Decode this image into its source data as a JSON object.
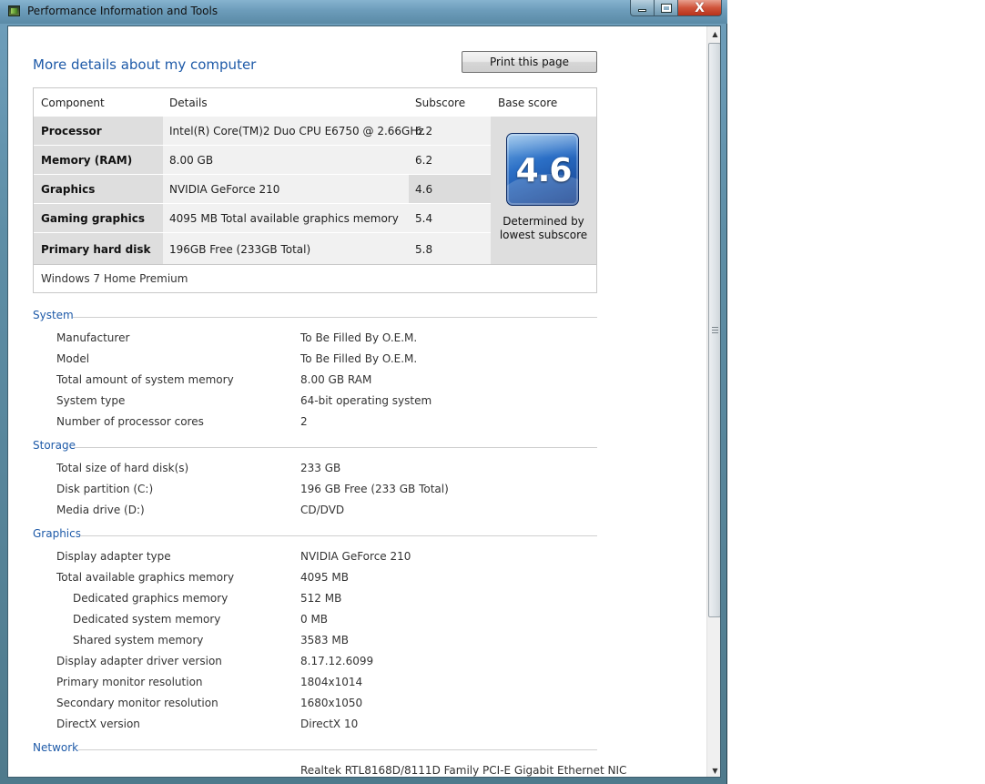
{
  "window": {
    "title": "Performance Information and Tools",
    "minimize_label": "",
    "maximize_label": "",
    "close_label": "X"
  },
  "page": {
    "heading": "More details about my computer",
    "print_label": "Print this page"
  },
  "score_table": {
    "headers": {
      "component": "Component",
      "details": "Details",
      "subscore": "Subscore",
      "base_score": "Base score"
    },
    "rows": [
      {
        "component": "Processor",
        "details": "Intel(R) Core(TM)2 Duo CPU E6750 @ 2.66GHz",
        "subscore": "6.2"
      },
      {
        "component": "Memory (RAM)",
        "details": "8.00 GB",
        "subscore": "6.2"
      },
      {
        "component": "Graphics",
        "details": "NVIDIA GeForce 210",
        "subscore": "4.6"
      },
      {
        "component": "Gaming graphics",
        "details": "4095 MB Total available graphics memory",
        "subscore": "5.4"
      },
      {
        "component": "Primary hard disk",
        "details": "196GB Free (233GB Total)",
        "subscore": "5.8"
      }
    ],
    "base_score": "4.6",
    "base_caption": "Determined by lowest subscore",
    "os": "Windows 7 Home Premium"
  },
  "sections": {
    "system": {
      "title": "System",
      "rows": [
        {
          "label": "Manufacturer",
          "value": "To Be Filled By O.E.M."
        },
        {
          "label": "Model",
          "value": "To Be Filled By O.E.M."
        },
        {
          "label": "Total amount of system memory",
          "value": "8.00 GB RAM"
        },
        {
          "label": "System type",
          "value": "64-bit operating system"
        },
        {
          "label": "Number of processor cores",
          "value": "2"
        }
      ]
    },
    "storage": {
      "title": "Storage",
      "rows": [
        {
          "label": "Total size of hard disk(s)",
          "value": "233 GB"
        },
        {
          "label": "Disk partition (C:)",
          "value": "196 GB Free (233 GB Total)"
        },
        {
          "label": "Media drive (D:)",
          "value": "CD/DVD"
        }
      ]
    },
    "graphics": {
      "title": "Graphics",
      "rows": [
        {
          "label": "Display adapter type",
          "value": "NVIDIA GeForce 210"
        },
        {
          "label": "Total available graphics memory",
          "value": "4095 MB"
        },
        {
          "label": "Dedicated graphics memory",
          "value": "512 MB"
        },
        {
          "label": "Dedicated system memory",
          "value": "0 MB"
        },
        {
          "label": "Shared system memory",
          "value": "3583 MB"
        },
        {
          "label": "Display adapter driver version",
          "value": "8.17.12.6099"
        },
        {
          "label": "Primary monitor resolution",
          "value": "1804x1014"
        },
        {
          "label": "Secondary monitor resolution",
          "value": "1680x1050"
        },
        {
          "label": "DirectX version",
          "value": "DirectX 10"
        }
      ]
    },
    "network": {
      "title": "Network",
      "rows": [
        {
          "label": "",
          "value": "Realtek RTL8168D/8111D Family PCI-E Gigabit Ethernet NIC"
        }
      ]
    }
  },
  "colors": {
    "accent_blue": "#1e5aa8",
    "component_cell": "#dedede",
    "details_cell": "#f1f1f1"
  },
  "icons": {
    "app": "performance-app-icon",
    "minimize": "minimize-icon",
    "maximize": "maximize-icon",
    "close": "close-icon",
    "scroll_up": "scroll-up-arrow-icon",
    "scroll_down": "scroll-down-arrow-icon"
  }
}
